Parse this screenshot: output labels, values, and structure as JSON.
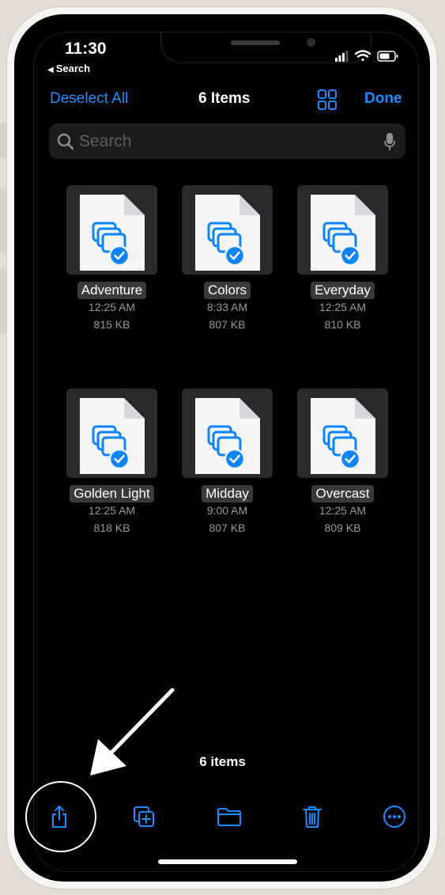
{
  "status_bar": {
    "time": "11:30",
    "back_label": "Search"
  },
  "nav": {
    "deselect_label": "Deselect All",
    "title": "6 Items",
    "done_label": "Done",
    "view_icon": "grid-icon"
  },
  "search": {
    "placeholder": "Search"
  },
  "files": [
    {
      "name": "Adventure",
      "time": "12:25 AM",
      "size": "815 KB"
    },
    {
      "name": "Colors",
      "time": "8:33 AM",
      "size": "807 KB"
    },
    {
      "name": "Everyday",
      "time": "12:25 AM",
      "size": "810 KB"
    },
    {
      "name": "Golden Light",
      "time": "12:25 AM",
      "size": "818 KB"
    },
    {
      "name": "Midday",
      "time": "9:00 AM",
      "size": "807 KB"
    },
    {
      "name": "Overcast",
      "time": "12:25 AM",
      "size": "809 KB"
    }
  ],
  "footer": {
    "count_label": "6 items"
  },
  "toolbar": {
    "share_icon": "share-icon",
    "duplicate_icon": "duplicate-icon",
    "move_icon": "folder-icon",
    "delete_icon": "trash-icon",
    "more_icon": "more-icon"
  },
  "colors": {
    "accent": "#1a8cff",
    "background": "#000000",
    "selected_badge": "#0a84ff"
  }
}
